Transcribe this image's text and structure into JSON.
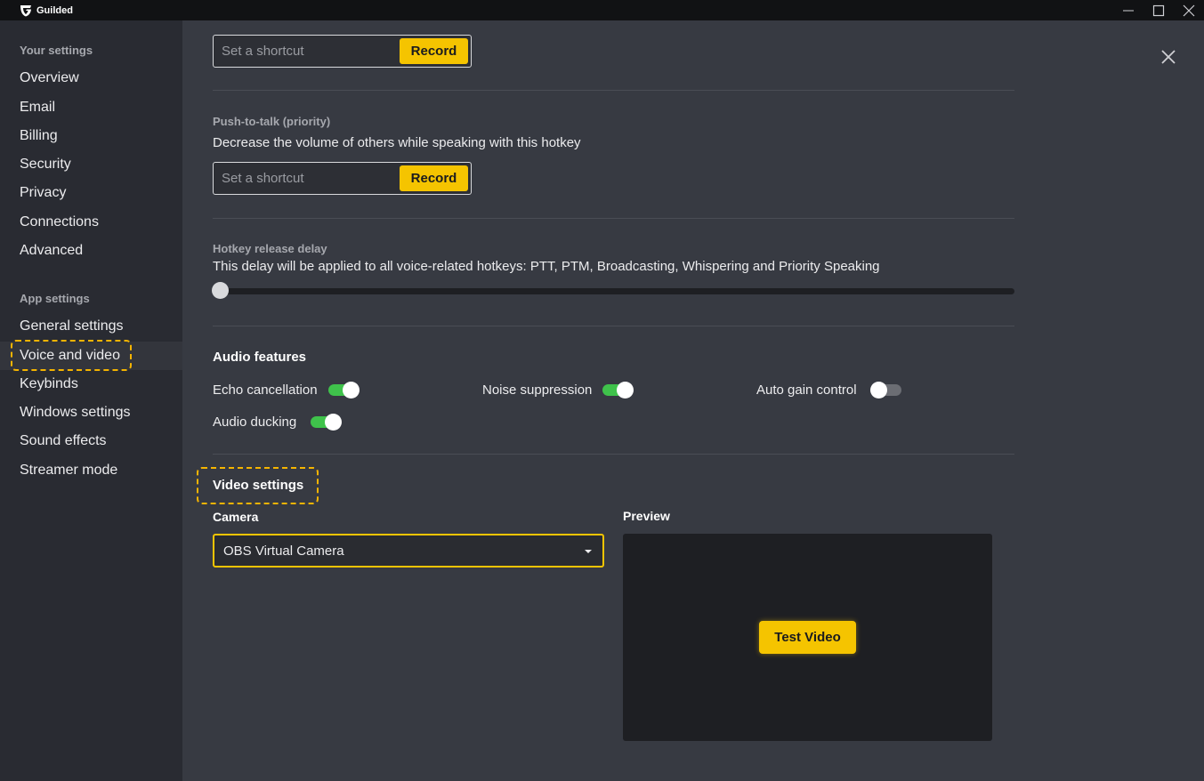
{
  "titlebar": {
    "app_name": "Guilded"
  },
  "sidebar": {
    "your_settings_heading": "Your settings",
    "your_settings_items": [
      {
        "label": "Overview"
      },
      {
        "label": "Email"
      },
      {
        "label": "Billing"
      },
      {
        "label": "Security"
      },
      {
        "label": "Privacy"
      },
      {
        "label": "Connections"
      },
      {
        "label": "Advanced"
      }
    ],
    "app_settings_heading": "App settings",
    "app_settings_items": [
      {
        "label": "General settings"
      },
      {
        "label": "Voice and video",
        "active": true
      },
      {
        "label": "Keybinds"
      },
      {
        "label": "Windows settings"
      },
      {
        "label": "Sound effects"
      },
      {
        "label": "Streamer mode"
      }
    ]
  },
  "main": {
    "shortcut_1": {
      "placeholder": "Set a shortcut",
      "button": "Record"
    },
    "push_to_talk_priority": {
      "title": "Push-to-talk (priority)",
      "description": "Decrease the volume of others while speaking with this hotkey",
      "placeholder": "Set a shortcut",
      "button": "Record"
    },
    "hotkey_release_delay": {
      "title": "Hotkey release delay",
      "description": "This delay will be applied to all voice-related hotkeys: PTT, PTM, Broadcasting, Whispering and Priority Speaking",
      "value": 0
    },
    "audio_features": {
      "heading": "Audio features",
      "toggles": [
        {
          "label": "Echo cancellation",
          "on": true
        },
        {
          "label": "Noise suppression",
          "on": true
        },
        {
          "label": "Auto gain control",
          "on": false
        },
        {
          "label": "Audio ducking",
          "on": true
        }
      ]
    },
    "video_settings": {
      "heading": "Video settings",
      "camera_label": "Camera",
      "camera_value": "OBS Virtual Camera",
      "preview_label": "Preview",
      "test_button": "Test Video"
    }
  },
  "colors": {
    "accent": "#f5c400",
    "toggle_on": "#3fc24b",
    "sidebar_bg": "#292b32",
    "main_bg": "#373a42"
  }
}
